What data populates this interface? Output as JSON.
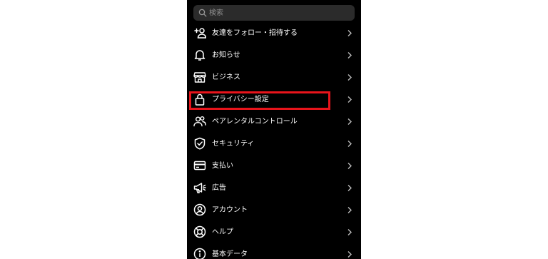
{
  "search": {
    "placeholder": "検索",
    "icon": "search-icon"
  },
  "menu": {
    "items": [
      {
        "label": "友達をフォロー・招待する",
        "icon": "add-person-icon"
      },
      {
        "label": "お知らせ",
        "icon": "bell-icon"
      },
      {
        "label": "ビジネス",
        "icon": "store-icon"
      },
      {
        "label": "プライバシー設定",
        "icon": "lock-icon",
        "highlighted": true
      },
      {
        "label": "ペアレンタルコントロール",
        "icon": "people-icon"
      },
      {
        "label": "セキュリティ",
        "icon": "shield-icon"
      },
      {
        "label": "支払い",
        "icon": "credit-card-icon"
      },
      {
        "label": "広告",
        "icon": "megaphone-icon"
      },
      {
        "label": "アカウント",
        "icon": "account-icon"
      },
      {
        "label": "ヘルプ",
        "icon": "lifebuoy-icon"
      },
      {
        "label": "基本データ",
        "icon": "info-icon"
      }
    ]
  },
  "colors": {
    "background": "#000000",
    "text": "#ffffff",
    "search_bg": "#2b2b2b",
    "highlight": "#e8141b"
  }
}
